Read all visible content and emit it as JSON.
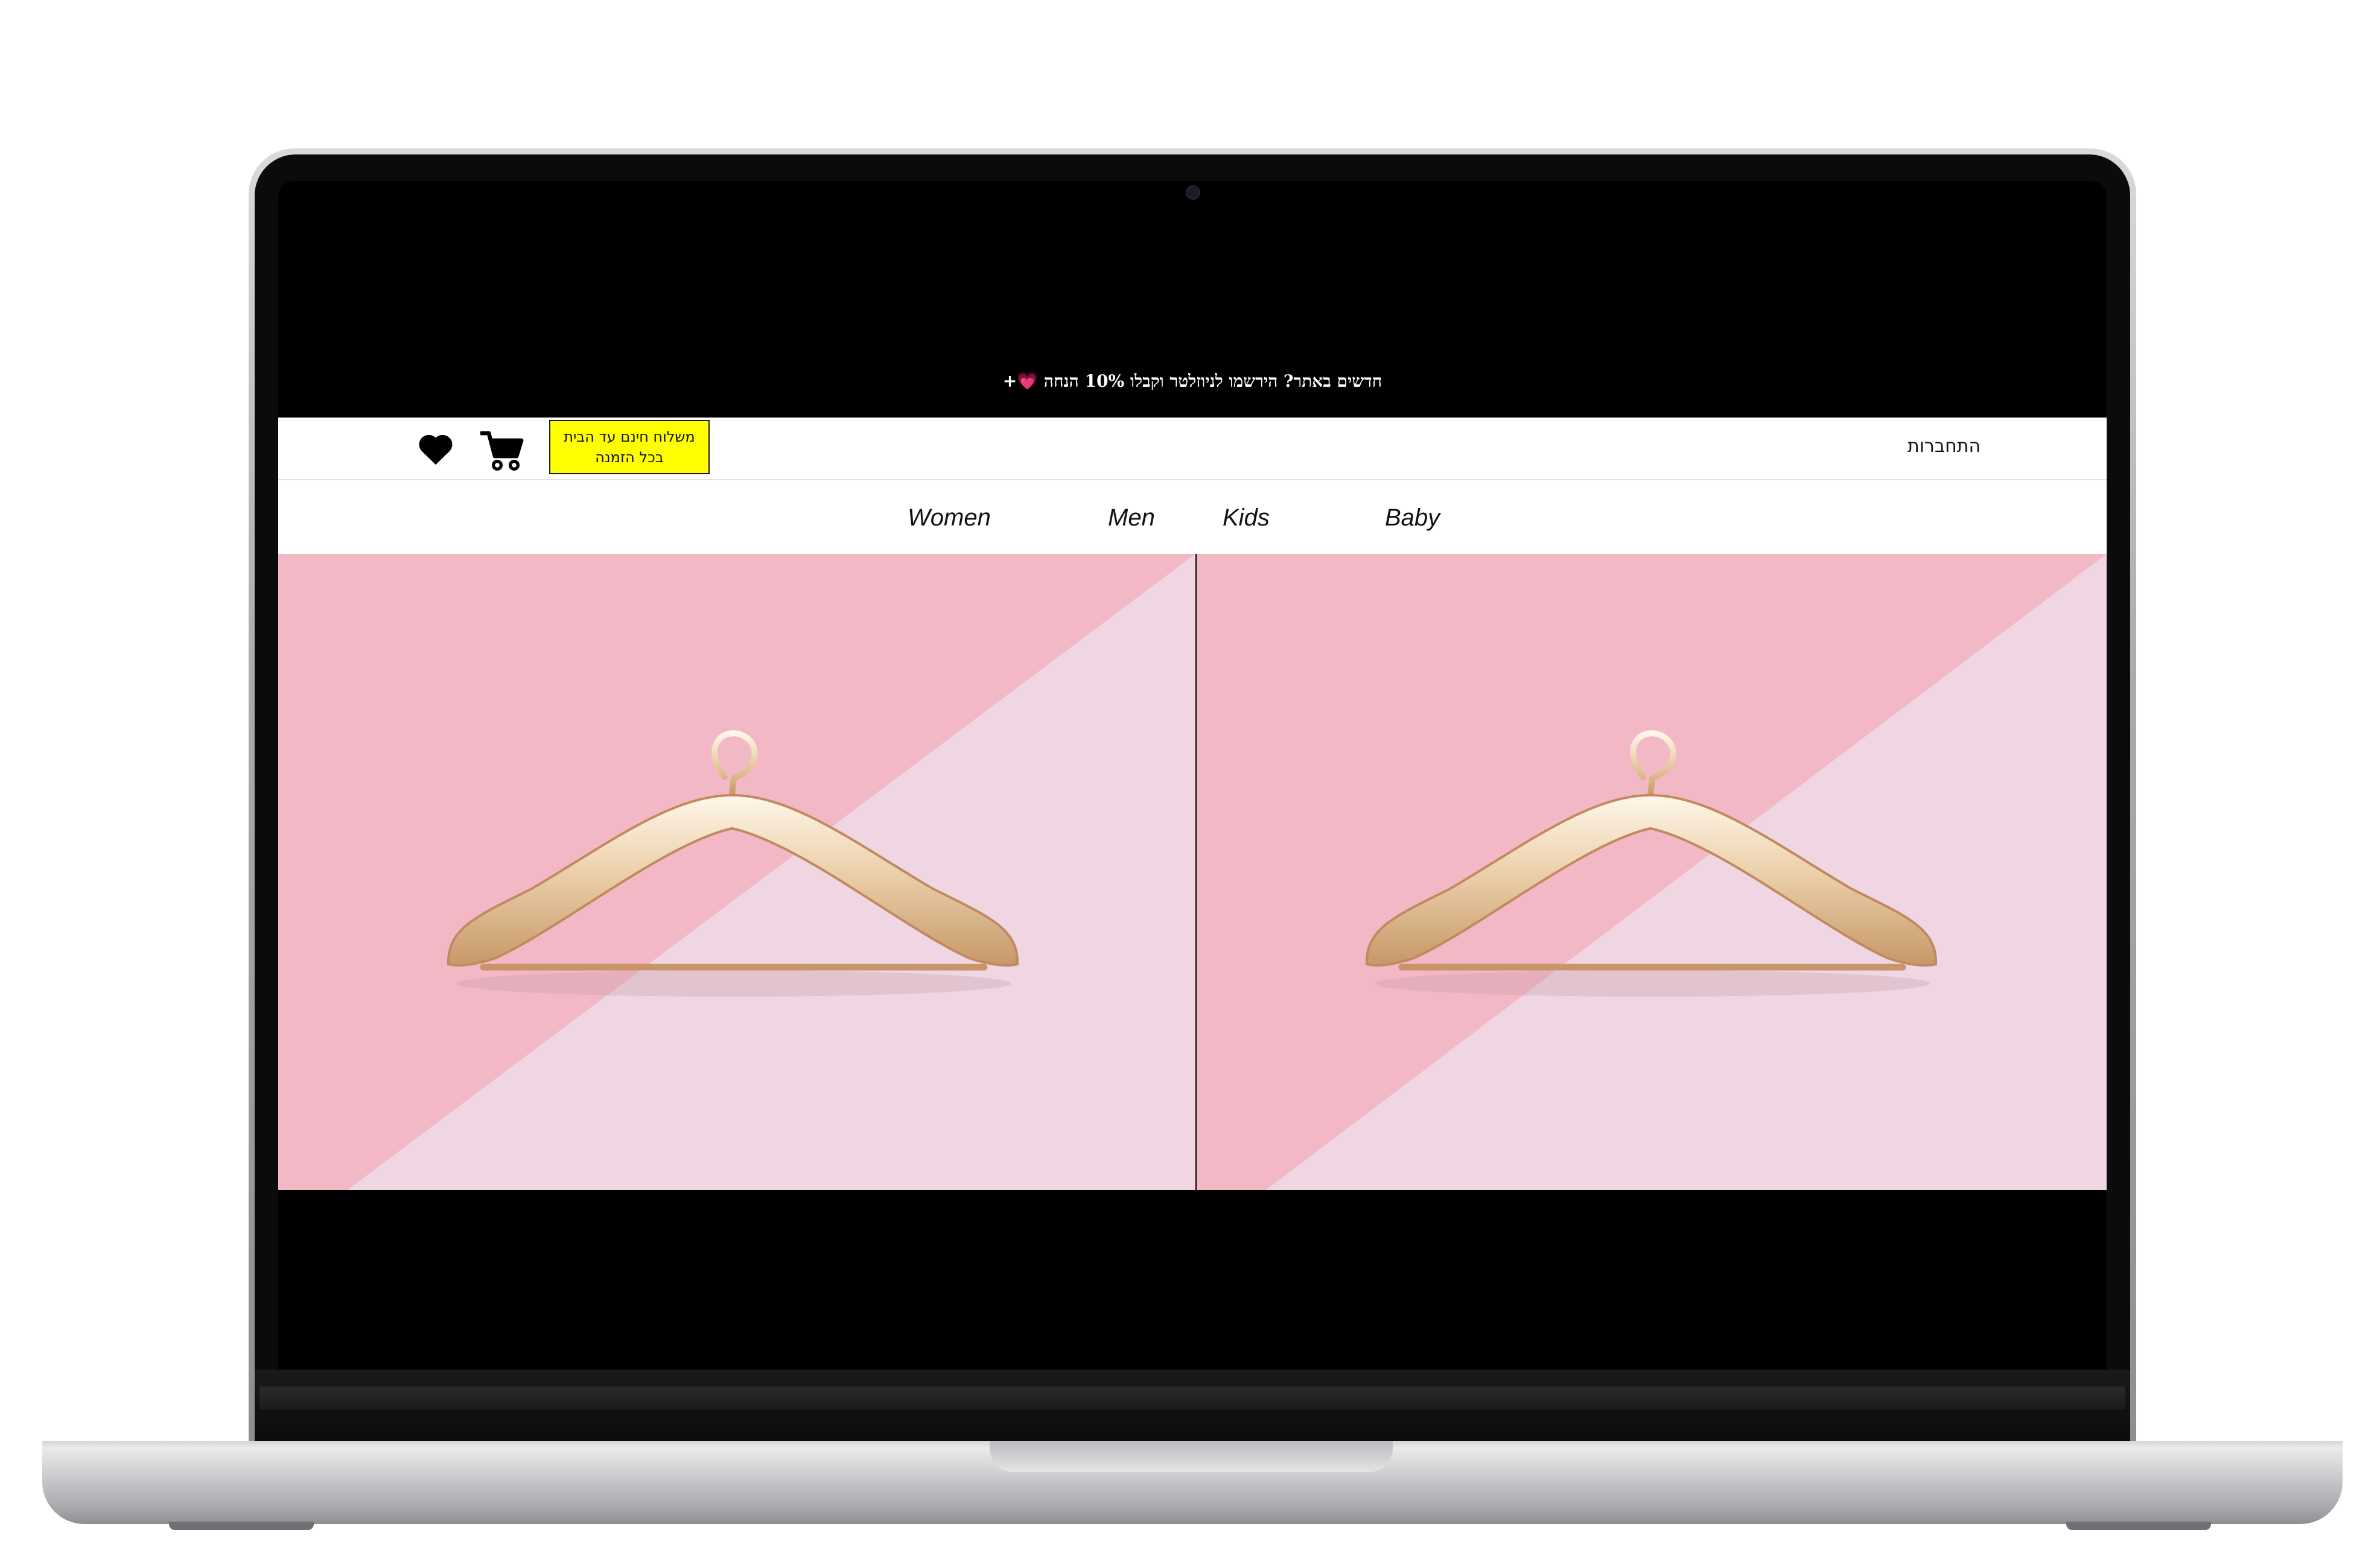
{
  "promo": {
    "icon": "heart-emoji-icon",
    "text": "+💗 חדשים באתר? הירשמו לניוזלטר וקבלו 10% הנחה"
  },
  "header": {
    "login_label": "התחברות",
    "shipping_line1": "משלוח חינם עד הבית",
    "shipping_line2": "בכל הזמנה",
    "cart_icon": "cart-icon",
    "favorites_icon": "heart-icon",
    "shipping_badge_color": "#ffff00"
  },
  "nav": {
    "items": [
      "Women",
      "Men",
      "Kids",
      "Baby"
    ]
  },
  "hero": {
    "banners": [
      {
        "image": "gold-hanger-on-pink-background"
      },
      {
        "image": "gold-hanger-on-pink-background"
      }
    ],
    "colors": {
      "pink_dark": "#f3b8c6",
      "pink_light": "#efd6e2",
      "gold": "#e9c9a2"
    }
  }
}
